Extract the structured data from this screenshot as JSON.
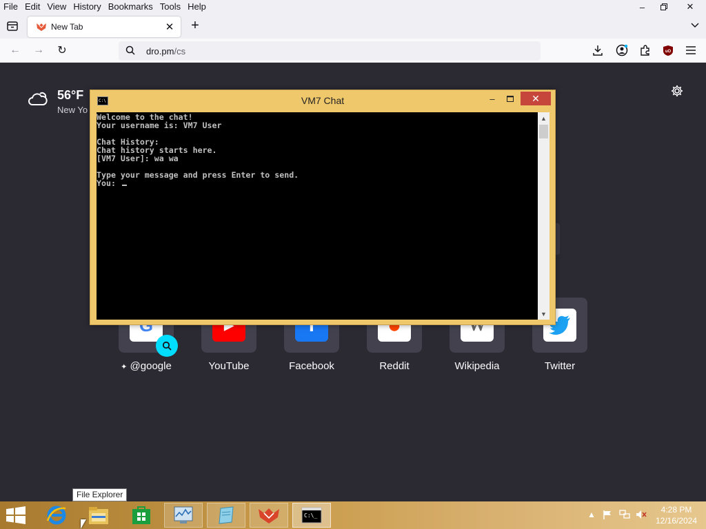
{
  "menubar": {
    "items": [
      "File",
      "Edit",
      "View",
      "History",
      "Bookmarks",
      "Tools",
      "Help"
    ]
  },
  "window_controls": {
    "minimize_icon": "minimize-icon",
    "restore_icon": "restore-icon",
    "close_icon": "close-icon"
  },
  "tabs": [
    {
      "title": "New Tab",
      "favicon": "firefox-logo-icon"
    }
  ],
  "navbar": {
    "url_host": "dro.pm",
    "url_path": "/cs"
  },
  "weather": {
    "temp": "56°F",
    "location": "New Yo"
  },
  "shortcuts": [
    {
      "label": "@google",
      "icon_text": "G",
      "color": "#4285f4"
    },
    {
      "label": "YouTube",
      "icon_text": "▶",
      "color": "#ff0000"
    },
    {
      "label": "Facebook",
      "icon_text": "f",
      "color": "#1877f2"
    },
    {
      "label": "Reddit",
      "icon_text": "●",
      "color": "#ff4500"
    },
    {
      "label": "Wikipedia",
      "icon_text": "W",
      "color": "#666666"
    },
    {
      "label": "Twitter",
      "icon_text": "🐦",
      "color": "#1da1f2"
    }
  ],
  "console": {
    "title": "VM7 Chat",
    "lines": [
      "Welcome to the chat!",
      "Your username is: VM7 User",
      "",
      "Chat History:",
      "Chat history starts here.",
      "[VM7 User]: wa wa",
      "",
      "Type your message and press Enter to send.",
      "You: "
    ]
  },
  "tooltip": "File Explorer",
  "clock": {
    "time": "4:28 PM",
    "date": "12/16/2024"
  }
}
